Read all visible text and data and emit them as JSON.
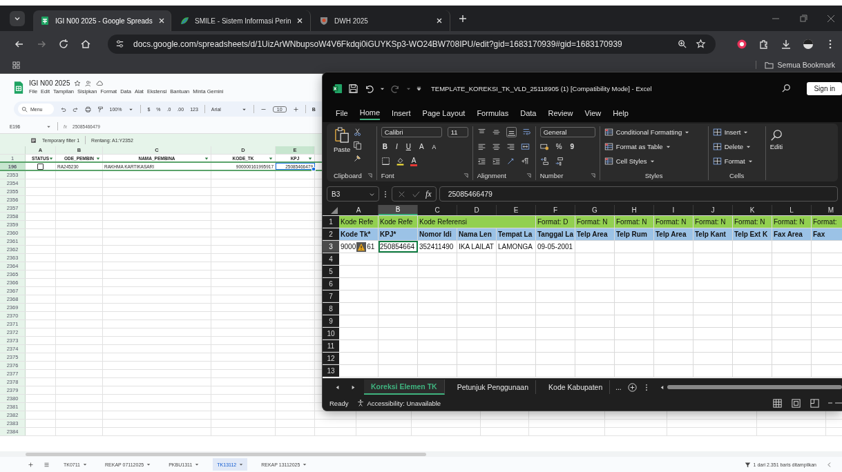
{
  "browser": {
    "tabs": [
      {
        "title": "IGI N00 2025 - Google Spreads",
        "kind": "sheets",
        "selected": true
      },
      {
        "title": "SMILE - Sistem Informasi Perin",
        "kind": "smile",
        "selected": false
      },
      {
        "title": "DWH 2025",
        "kind": "shield",
        "selected": false
      }
    ],
    "url": "docs.google.com/spreadsheets/d/1UizArWNbupsoW4V6Fkdqi0iGUYKSp3-WO24BW708IPU/edit?gid=1683170939#gid=1683170939",
    "bookmarks": "Semua Bookmark"
  },
  "sheets": {
    "title": "IGI N00 2025",
    "menus": [
      "File",
      "Edit",
      "Tampilan",
      "Sisipkan",
      "Format",
      "Data",
      "Alat",
      "Ekstensi",
      "Bantuan",
      "Minta Gemini"
    ],
    "toolbar": {
      "search": "Menu",
      "zoom": "100%",
      "currency": "$",
      "percent": "%",
      "decimal_less": ".0",
      "decimal_more": ".00",
      "number_format": "123",
      "font": "Arial",
      "font_size": "10",
      "bold": "B"
    },
    "name_box": "E196",
    "fx": "fx",
    "formula": "25085466479",
    "filter": {
      "name": "Temporary filter 1",
      "range": "Rentang: A1:Y2352"
    },
    "columns": [
      {
        "label": "A",
        "selected": false
      },
      {
        "label": "B",
        "selected": false
      },
      {
        "label": "C",
        "selected": false
      },
      {
        "label": "D",
        "selected": false
      },
      {
        "label": "E",
        "selected": true
      }
    ],
    "rows": [
      {
        "number": "1",
        "kind": "header",
        "selected": false,
        "cells": [
          "STATUS",
          "ODE_PEMBIN",
          "NAMA_PEMBINA",
          "KODE_TK",
          "KPJ"
        ]
      },
      {
        "number": "196",
        "kind": "data",
        "selected": true,
        "checked": false,
        "cells": [
          null,
          "RA245230",
          "RAKHMA KARTIKASARI",
          "900000161995917",
          "25085466479"
        ]
      },
      {
        "number": "2353",
        "kind": "empty",
        "selected": false
      },
      {
        "number": "2354",
        "kind": "empty",
        "selected": false
      },
      {
        "number": "2355",
        "kind": "empty",
        "selected": false
      },
      {
        "number": "2356",
        "kind": "empty",
        "selected": false
      },
      {
        "number": "2357",
        "kind": "empty",
        "selected": false
      },
      {
        "number": "2358",
        "kind": "empty",
        "selected": false
      },
      {
        "number": "2359",
        "kind": "empty",
        "selected": false
      },
      {
        "number": "2360",
        "kind": "empty",
        "selected": false
      },
      {
        "number": "2361",
        "kind": "empty",
        "selected": false
      },
      {
        "number": "2362",
        "kind": "empty",
        "selected": false
      },
      {
        "number": "2363",
        "kind": "empty",
        "selected": false
      },
      {
        "number": "2364",
        "kind": "empty",
        "selected": false
      },
      {
        "number": "2365",
        "kind": "empty",
        "selected": false
      },
      {
        "number": "2366",
        "kind": "empty",
        "selected": false
      },
      {
        "number": "2367",
        "kind": "empty",
        "selected": false
      },
      {
        "number": "2368",
        "kind": "empty",
        "selected": false
      },
      {
        "number": "2369",
        "kind": "empty",
        "selected": false
      },
      {
        "number": "2370",
        "kind": "empty",
        "selected": false
      },
      {
        "number": "2371",
        "kind": "empty",
        "selected": false
      },
      {
        "number": "2372",
        "kind": "empty",
        "selected": false
      },
      {
        "number": "2373",
        "kind": "empty",
        "selected": false
      },
      {
        "number": "2374",
        "kind": "empty",
        "selected": false
      },
      {
        "number": "2375",
        "kind": "empty",
        "selected": false
      },
      {
        "number": "2376",
        "kind": "empty",
        "selected": false
      },
      {
        "number": "2377",
        "kind": "empty",
        "selected": false
      },
      {
        "number": "2378",
        "kind": "empty",
        "selected": false
      },
      {
        "number": "2379",
        "kind": "empty",
        "selected": false
      },
      {
        "number": "2380",
        "kind": "empty",
        "selected": false
      },
      {
        "number": "2381",
        "kind": "empty",
        "selected": false
      },
      {
        "number": "2382",
        "kind": "empty",
        "selected": false
      },
      {
        "number": "2383",
        "kind": "empty",
        "selected": false
      },
      {
        "number": "2384",
        "kind": "empty",
        "selected": false
      }
    ],
    "sheet_tabs": [
      {
        "label": "TK0711",
        "selected": false
      },
      {
        "label": "REKAP 07112025",
        "selected": false
      },
      {
        "label": "PKBU1311",
        "selected": false
      },
      {
        "label": "TK13112",
        "selected": true
      },
      {
        "label": "REKAP 13112025",
        "selected": false
      }
    ],
    "status": "1 dari 2.351 baris ditampilkan"
  },
  "excel": {
    "title": "TEMPLATE_KOREKSI_TK_VLD_25118905 (1)  [Compatibility Mode]  -  Excel",
    "sign_in": "Sign in",
    "tabs": [
      {
        "label": "File",
        "selected": false
      },
      {
        "label": "Home",
        "selected": true
      },
      {
        "label": "Insert",
        "selected": false
      },
      {
        "label": "Page Layout",
        "selected": false
      },
      {
        "label": "Formulas",
        "selected": false
      },
      {
        "label": "Data",
        "selected": false
      },
      {
        "label": "Review",
        "selected": false
      },
      {
        "label": "View",
        "selected": false
      },
      {
        "label": "Help",
        "selected": false
      }
    ],
    "ribbon": {
      "paste": "Paste",
      "font": "Calibri",
      "font_size": "11",
      "bold": "B",
      "italic": "I",
      "underline": "U",
      "grow": "A",
      "shrink": "A",
      "font_color": "A",
      "number_format": "General",
      "percent": "%",
      "comma": "9",
      "styles": [
        "Conditional Formatting",
        "Format as Table",
        "Cell Styles"
      ],
      "cells": [
        "Insert",
        "Delete",
        "Format"
      ],
      "editing": "Editi",
      "groups": [
        "Clipboard",
        "Font",
        "Alignment",
        "Number",
        "Styles",
        "Cells"
      ]
    },
    "name_box": "B3",
    "fx": "fx",
    "formula": "25085466479",
    "columns": [
      {
        "label": "A",
        "selected": false
      },
      {
        "label": "B",
        "selected": true
      },
      {
        "label": "C",
        "selected": false
      },
      {
        "label": "D",
        "selected": false
      },
      {
        "label": "E",
        "selected": false
      },
      {
        "label": "F",
        "selected": false
      },
      {
        "label": "G",
        "selected": false
      },
      {
        "label": "H",
        "selected": false
      },
      {
        "label": "I",
        "selected": false
      },
      {
        "label": "J",
        "selected": false
      },
      {
        "label": "K",
        "selected": false
      },
      {
        "label": "L",
        "selected": false
      },
      {
        "label": "M",
        "selected": false
      }
    ],
    "rows": [
      {
        "number": "1",
        "kind": "note",
        "selected": false,
        "cells": [
          "Kode Refe",
          "Kode Refe",
          "Kode Referensi",
          null,
          null,
          "Format: D",
          "Format: N",
          "Format: N",
          "Format: N",
          "Format: N",
          "Format: N",
          "Format: N",
          "Format:"
        ]
      },
      {
        "number": "2",
        "kind": "header",
        "selected": false,
        "cells": [
          "Kode Tk*",
          "KPJ*",
          "Nomor Idi",
          "Nama Len",
          "Tempat La",
          "Tanggal La",
          "Telp Area",
          "Telp Rum",
          "Telp Area",
          "Telp Kant",
          "Telp Ext K",
          "Fax Area",
          "Fax"
        ]
      },
      {
        "number": "3",
        "kind": "data",
        "selected": true,
        "cells": [
          {
            "text": "9000",
            "warning": true,
            "after": "61"
          },
          "250854664",
          "352411490",
          "IKA LAILAT",
          "LAMONGA",
          "09-05-2001"
        ]
      },
      {
        "number": "4",
        "kind": "empty",
        "selected": false
      },
      {
        "number": "5",
        "kind": "empty",
        "selected": false
      },
      {
        "number": "6",
        "kind": "empty",
        "selected": false
      },
      {
        "number": "7",
        "kind": "empty",
        "selected": false
      },
      {
        "number": "8",
        "kind": "empty",
        "selected": false
      },
      {
        "number": "9",
        "kind": "empty",
        "selected": false
      },
      {
        "number": "10",
        "kind": "empty",
        "selected": false
      },
      {
        "number": "11",
        "kind": "empty",
        "selected": false
      },
      {
        "number": "12",
        "kind": "empty",
        "selected": false
      },
      {
        "number": "13",
        "kind": "empty",
        "selected": false
      }
    ],
    "sheet_tabs": [
      {
        "label": "Koreksi Elemen TK",
        "selected": true
      },
      {
        "label": "Petunjuk Penggunaan",
        "selected": false
      },
      {
        "label": "Kode Kabupaten",
        "selected": false
      }
    ],
    "more_tabs": "...",
    "status": "Ready",
    "accessibility": "Accessibility: Unavailable"
  }
}
